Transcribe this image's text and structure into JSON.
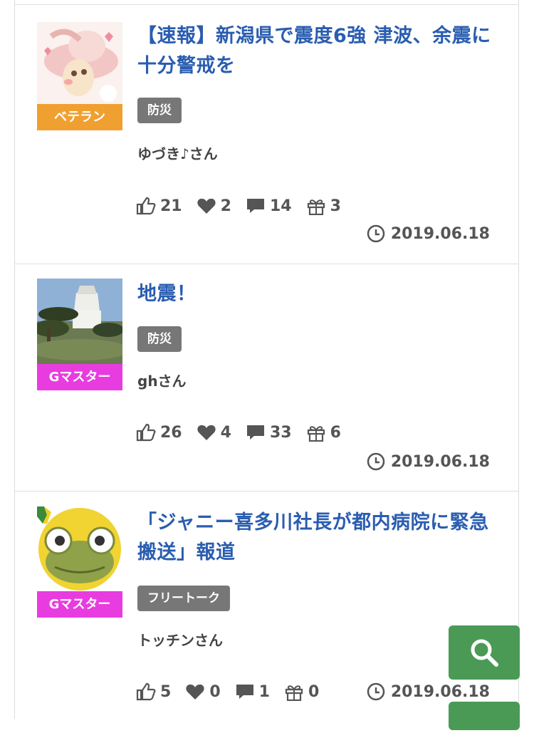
{
  "posts": [
    {
      "title": "【速報】新潟県で震度6強 津波、余震に十分警戒を",
      "tag": "防災",
      "author": "ゆづき♪さん",
      "badge": "ベテラン",
      "badge_color": "#f0a030",
      "likes": "21",
      "hearts": "2",
      "comments": "14",
      "gifts": "3",
      "date": "2019.06.18"
    },
    {
      "title": "地震！",
      "tag": "防災",
      "author": "ghさん",
      "badge": "Gマスター",
      "badge_color": "#e83ce0",
      "likes": "26",
      "hearts": "4",
      "comments": "33",
      "gifts": "6",
      "date": "2019.06.18"
    },
    {
      "title": "「ジャニー喜多川社長が都内病院に緊急搬送」報道",
      "tag": "フリートーク",
      "author": "トッチンさん",
      "badge": "Gマスター",
      "badge_color": "#e83ce0",
      "likes": "5",
      "hearts": "0",
      "comments": "1",
      "gifts": "0",
      "date": "2019.06.18"
    }
  ],
  "icons": {
    "like": "thumbs-up-icon",
    "heart": "heart-icon",
    "comment": "comment-icon",
    "gift": "gift-icon",
    "clock": "clock-icon",
    "search": "search-icon"
  },
  "colors": {
    "title": "#2a5db0",
    "tag_bg": "#777777",
    "search_button": "#4a9a55"
  }
}
